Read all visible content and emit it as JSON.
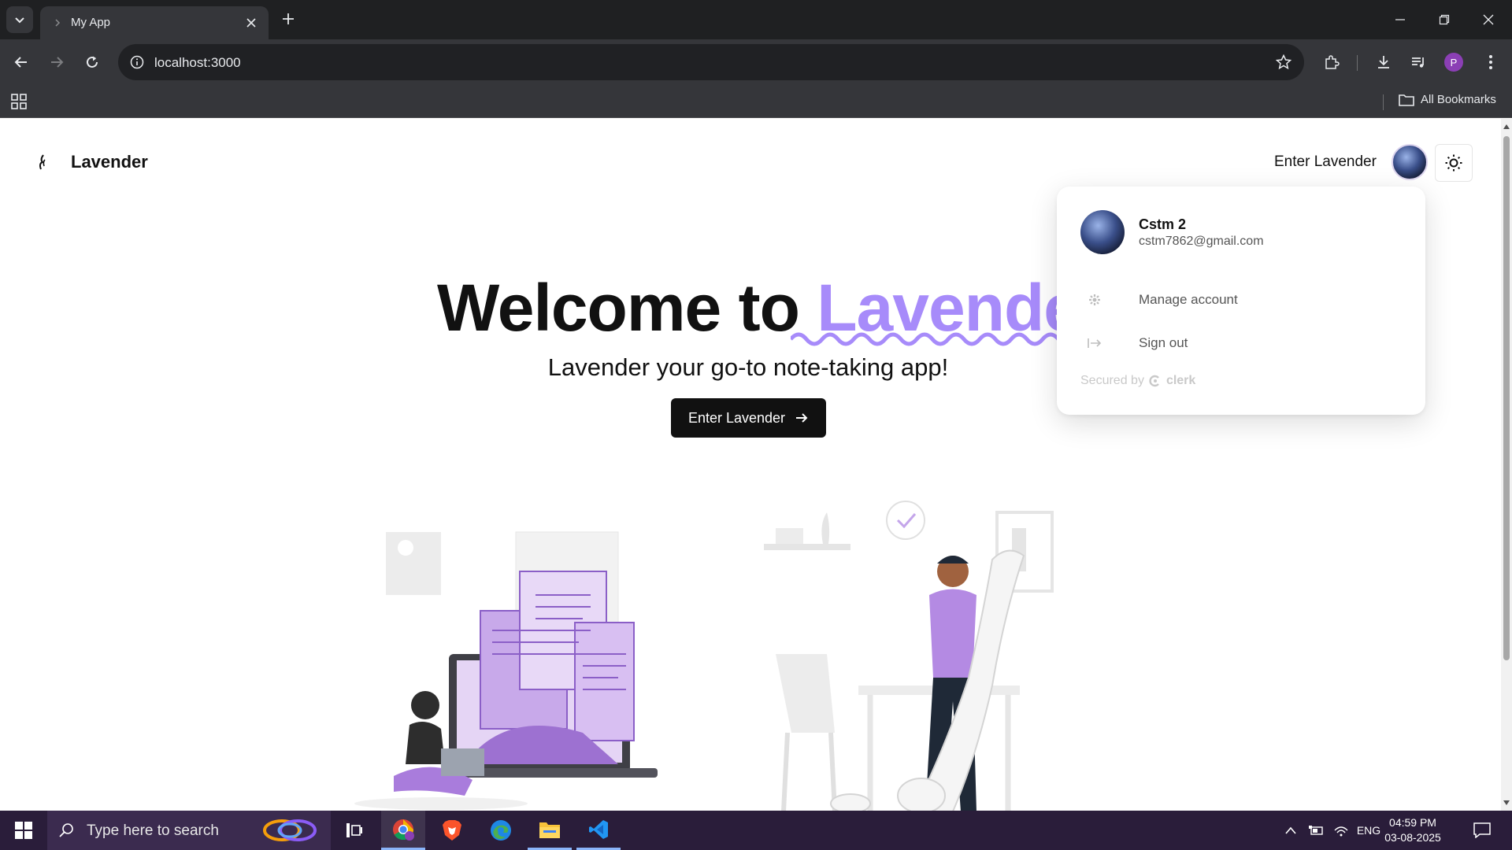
{
  "browser": {
    "tab_title": "My App",
    "url": "localhost:3000",
    "bookmarks_label": "All Bookmarks",
    "profile_initial": "P"
  },
  "nav": {
    "brand": "Lavender",
    "enter_link": "Enter Lavender"
  },
  "hero": {
    "title_prefix": "Welcome to ",
    "title_accent": "Lavender",
    "subtitle": "Lavender your go-to note-taking app!",
    "cta_label": "Enter Lavender"
  },
  "user_menu": {
    "name": "Cstm 2",
    "email": "cstm7862@gmail.com",
    "items": [
      {
        "label": "Manage account",
        "icon": "gear-icon"
      },
      {
        "label": "Sign out",
        "icon": "sign-out-icon"
      }
    ],
    "secured_by": "Secured by",
    "provider": "clerk"
  },
  "taskbar": {
    "search_placeholder": "Type here to search",
    "language": "ENG",
    "time": "04:59 PM",
    "date": "03-08-2025"
  },
  "colors": {
    "accent": "#a78bfa",
    "taskbar": "#2a1d3a"
  }
}
